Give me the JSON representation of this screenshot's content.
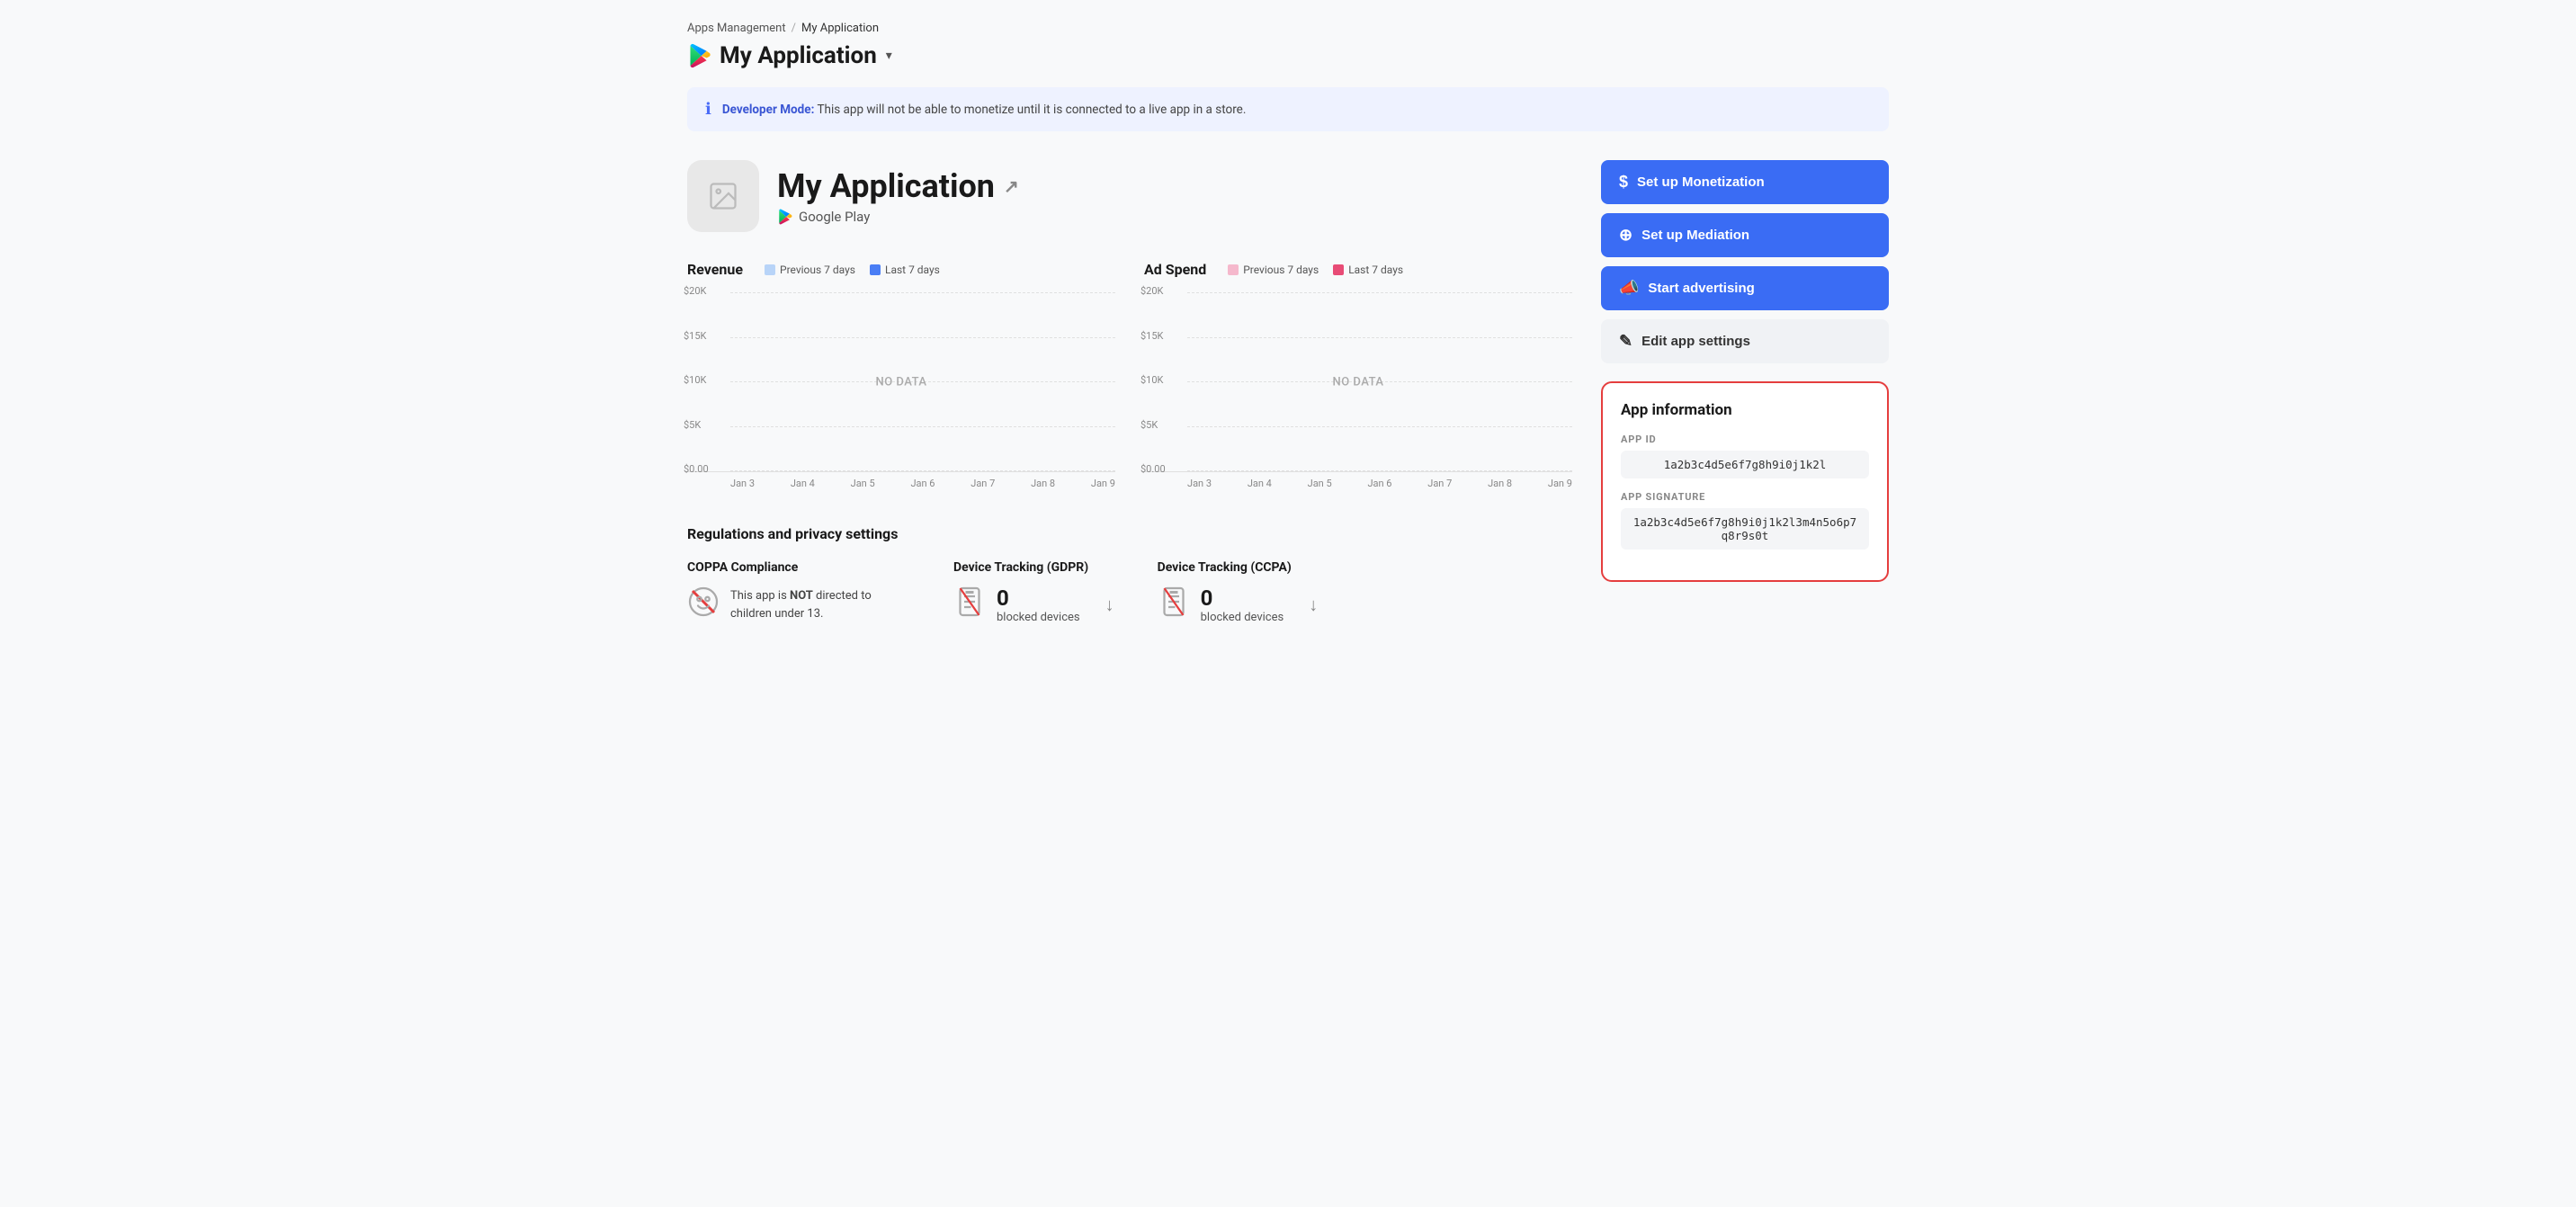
{
  "breadcrumb": {
    "parent_label": "Apps Management",
    "separator": "/",
    "current_label": "My Application"
  },
  "app_header": {
    "title": "My Application",
    "dropdown_arrow": "▾"
  },
  "dev_banner": {
    "label": "Developer Mode:",
    "message": " This app will not be able to monetize until it is connected to a live app in a store."
  },
  "app_card": {
    "name": "My Application",
    "platform": "Google Play"
  },
  "revenue_chart": {
    "title": "Revenue",
    "legend_prev": "Previous 7 days",
    "legend_last": "Last 7 days",
    "no_data": "NO DATA",
    "y_labels": [
      "$20K",
      "$15K",
      "$10K",
      "$5K",
      "$0.00"
    ],
    "x_labels": [
      "Jan 3",
      "Jan 4",
      "Jan 5",
      "Jan 6",
      "Jan 7",
      "Jan 8",
      "Jan 9"
    ]
  },
  "adspend_chart": {
    "title": "Ad Spend",
    "legend_prev": "Previous 7 days",
    "legend_last": "Last 7 days",
    "no_data": "NO DATA",
    "y_labels": [
      "$20K",
      "$15K",
      "$10K",
      "$5K",
      "$0.00"
    ],
    "x_labels": [
      "Jan 3",
      "Jan 4",
      "Jan 5",
      "Jan 6",
      "Jan 7",
      "Jan 8",
      "Jan 9"
    ]
  },
  "regulations": {
    "section_title": "Regulations and privacy settings",
    "coppa": {
      "title": "COPPA Compliance",
      "description_part1": "This app is ",
      "description_bold": "NOT",
      "description_part2": " directed to children under 13."
    },
    "gdpr": {
      "title": "Device Tracking (GDPR)",
      "blocked_count": "0",
      "blocked_label": "blocked devices"
    },
    "ccpa": {
      "title": "Device Tracking (CCPA)",
      "blocked_count": "0",
      "blocked_label": "blocked devices"
    }
  },
  "buttons": {
    "monetization_label": "Set up Monetization",
    "mediation_label": "Set up Mediation",
    "advertising_label": "Start advertising",
    "edit_label": "Edit app settings"
  },
  "app_info_panel": {
    "title": "App information",
    "app_id_label": "APP ID",
    "app_id_value": "1a2b3c4d5e6f7g8h9i0j1k2l",
    "app_sig_label": "APP SIGNATURE",
    "app_sig_value": "1a2b3c4d5e6f7g8h9i0j1k2l3m4n5o6p7q8r9s0t"
  }
}
